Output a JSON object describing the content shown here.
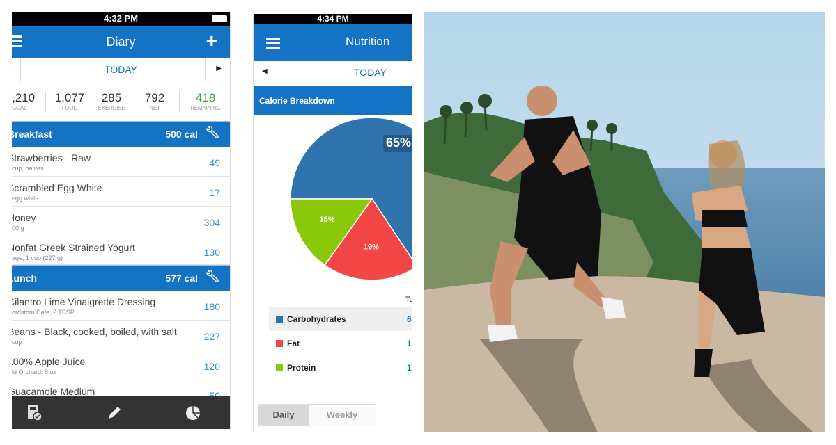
{
  "diary": {
    "status_time": "4:32 PM",
    "title": "Diary",
    "date": "TODAY",
    "stats": [
      {
        "value": ",210",
        "label": "GOAL"
      },
      {
        "value": "1,077",
        "label": "FOOD"
      },
      {
        "value": "285",
        "label": "EXERCISE"
      },
      {
        "value": "792",
        "label": "NET"
      },
      {
        "value": "418",
        "label": "REMAINING"
      }
    ],
    "meals": [
      {
        "name": "Breakfast",
        "cal": "500 cal",
        "items": [
          {
            "name": "Strawberries - Raw",
            "sub": "cup, halves",
            "cal": "49"
          },
          {
            "name": "Scrambled Egg White",
            "sub": "egg white",
            "cal": "17"
          },
          {
            "name": "Honey",
            "sub": "00 g",
            "cal": "304"
          },
          {
            "name": "Nonfat Greek Strained Yogurt",
            "sub": "age, 1 cup (227 g)",
            "cal": "130"
          }
        ]
      },
      {
        "name": "Lunch",
        "cal": "577 cal",
        "items": [
          {
            "name": "Cilantro Lime Vinaigrette Dressing",
            "sub": "ordstom Cafe, 2 TBSP",
            "cal": "180"
          },
          {
            "name": "Beans - Black, cooked, boiled, with salt",
            "sub": "cup",
            "cal": "227"
          },
          {
            "name": "100% Apple Juice",
            "sub": "ld Orchard, 8 oz",
            "cal": "120"
          },
          {
            "name": "Guacamole Medium",
            "sub": "",
            "cal": "50"
          }
        ]
      }
    ],
    "colors": {
      "accent": "#1473c4",
      "remaining": "#3aa03a",
      "bottombar": "#333333"
    }
  },
  "nutrition": {
    "status_time": "4:34 PM",
    "title": "Nutrition",
    "date": "TODAY",
    "section": "Calorie Breakdown",
    "table_header": "To",
    "tabs": [
      "Daily",
      "Weekly"
    ],
    "active_tab": "Daily",
    "legend_values": [
      "6",
      "1",
      "1"
    ]
  },
  "chart_data": {
    "type": "pie",
    "title": "Calorie Breakdown",
    "slices": [
      {
        "name": "Carbohydrates",
        "value": 65,
        "label": "65%",
        "color": "#2f74ad"
      },
      {
        "name": "Fat",
        "value": 19,
        "label": "19%",
        "color": "#f44646"
      },
      {
        "name": "Protein",
        "value": 15,
        "label": "15%",
        "color": "#8cc80a"
      }
    ],
    "legend": "bottom"
  }
}
